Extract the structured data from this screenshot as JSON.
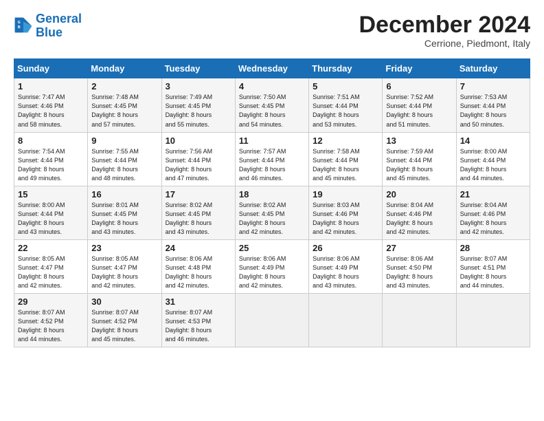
{
  "header": {
    "logo_line1": "General",
    "logo_line2": "Blue",
    "month": "December 2024",
    "location": "Cerrione, Piedmont, Italy"
  },
  "weekdays": [
    "Sunday",
    "Monday",
    "Tuesday",
    "Wednesday",
    "Thursday",
    "Friday",
    "Saturday"
  ],
  "weeks": [
    [
      {
        "day": "1",
        "info": "Sunrise: 7:47 AM\nSunset: 4:46 PM\nDaylight: 8 hours\nand 58 minutes."
      },
      {
        "day": "2",
        "info": "Sunrise: 7:48 AM\nSunset: 4:45 PM\nDaylight: 8 hours\nand 57 minutes."
      },
      {
        "day": "3",
        "info": "Sunrise: 7:49 AM\nSunset: 4:45 PM\nDaylight: 8 hours\nand 55 minutes."
      },
      {
        "day": "4",
        "info": "Sunrise: 7:50 AM\nSunset: 4:45 PM\nDaylight: 8 hours\nand 54 minutes."
      },
      {
        "day": "5",
        "info": "Sunrise: 7:51 AM\nSunset: 4:44 PM\nDaylight: 8 hours\nand 53 minutes."
      },
      {
        "day": "6",
        "info": "Sunrise: 7:52 AM\nSunset: 4:44 PM\nDaylight: 8 hours\nand 51 minutes."
      },
      {
        "day": "7",
        "info": "Sunrise: 7:53 AM\nSunset: 4:44 PM\nDaylight: 8 hours\nand 50 minutes."
      }
    ],
    [
      {
        "day": "8",
        "info": "Sunrise: 7:54 AM\nSunset: 4:44 PM\nDaylight: 8 hours\nand 49 minutes."
      },
      {
        "day": "9",
        "info": "Sunrise: 7:55 AM\nSunset: 4:44 PM\nDaylight: 8 hours\nand 48 minutes."
      },
      {
        "day": "10",
        "info": "Sunrise: 7:56 AM\nSunset: 4:44 PM\nDaylight: 8 hours\nand 47 minutes."
      },
      {
        "day": "11",
        "info": "Sunrise: 7:57 AM\nSunset: 4:44 PM\nDaylight: 8 hours\nand 46 minutes."
      },
      {
        "day": "12",
        "info": "Sunrise: 7:58 AM\nSunset: 4:44 PM\nDaylight: 8 hours\nand 45 minutes."
      },
      {
        "day": "13",
        "info": "Sunrise: 7:59 AM\nSunset: 4:44 PM\nDaylight: 8 hours\nand 45 minutes."
      },
      {
        "day": "14",
        "info": "Sunrise: 8:00 AM\nSunset: 4:44 PM\nDaylight: 8 hours\nand 44 minutes."
      }
    ],
    [
      {
        "day": "15",
        "info": "Sunrise: 8:00 AM\nSunset: 4:44 PM\nDaylight: 8 hours\nand 43 minutes."
      },
      {
        "day": "16",
        "info": "Sunrise: 8:01 AM\nSunset: 4:45 PM\nDaylight: 8 hours\nand 43 minutes."
      },
      {
        "day": "17",
        "info": "Sunrise: 8:02 AM\nSunset: 4:45 PM\nDaylight: 8 hours\nand 43 minutes."
      },
      {
        "day": "18",
        "info": "Sunrise: 8:02 AM\nSunset: 4:45 PM\nDaylight: 8 hours\nand 42 minutes."
      },
      {
        "day": "19",
        "info": "Sunrise: 8:03 AM\nSunset: 4:46 PM\nDaylight: 8 hours\nand 42 minutes."
      },
      {
        "day": "20",
        "info": "Sunrise: 8:04 AM\nSunset: 4:46 PM\nDaylight: 8 hours\nand 42 minutes."
      },
      {
        "day": "21",
        "info": "Sunrise: 8:04 AM\nSunset: 4:46 PM\nDaylight: 8 hours\nand 42 minutes."
      }
    ],
    [
      {
        "day": "22",
        "info": "Sunrise: 8:05 AM\nSunset: 4:47 PM\nDaylight: 8 hours\nand 42 minutes."
      },
      {
        "day": "23",
        "info": "Sunrise: 8:05 AM\nSunset: 4:47 PM\nDaylight: 8 hours\nand 42 minutes."
      },
      {
        "day": "24",
        "info": "Sunrise: 8:06 AM\nSunset: 4:48 PM\nDaylight: 8 hours\nand 42 minutes."
      },
      {
        "day": "25",
        "info": "Sunrise: 8:06 AM\nSunset: 4:49 PM\nDaylight: 8 hours\nand 42 minutes."
      },
      {
        "day": "26",
        "info": "Sunrise: 8:06 AM\nSunset: 4:49 PM\nDaylight: 8 hours\nand 43 minutes."
      },
      {
        "day": "27",
        "info": "Sunrise: 8:06 AM\nSunset: 4:50 PM\nDaylight: 8 hours\nand 43 minutes."
      },
      {
        "day": "28",
        "info": "Sunrise: 8:07 AM\nSunset: 4:51 PM\nDaylight: 8 hours\nand 44 minutes."
      }
    ],
    [
      {
        "day": "29",
        "info": "Sunrise: 8:07 AM\nSunset: 4:52 PM\nDaylight: 8 hours\nand 44 minutes."
      },
      {
        "day": "30",
        "info": "Sunrise: 8:07 AM\nSunset: 4:52 PM\nDaylight: 8 hours\nand 45 minutes."
      },
      {
        "day": "31",
        "info": "Sunrise: 8:07 AM\nSunset: 4:53 PM\nDaylight: 8 hours\nand 46 minutes."
      },
      null,
      null,
      null,
      null
    ]
  ]
}
